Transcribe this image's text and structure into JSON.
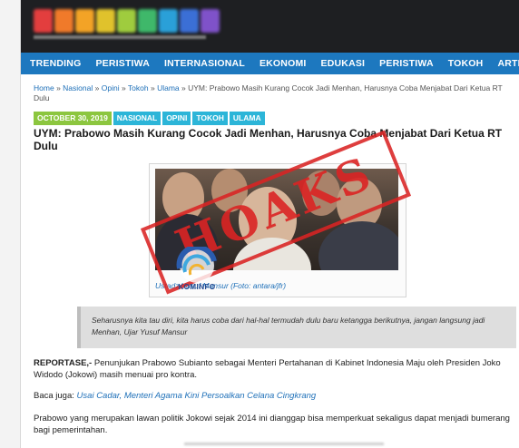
{
  "nav": {
    "items": [
      "TRENDING",
      "PERISTIWA",
      "INTERNASIONAL",
      "EKONOMI",
      "EDUKASI",
      "PERISTIWA",
      "TOKOH",
      "ARTIS"
    ]
  },
  "breadcrumb": {
    "home": "Home",
    "sep": "»",
    "nasional": "Nasional",
    "opini": "Opini",
    "tokoh": "Tokoh",
    "ulama": "Ulama",
    "current": "UYM: Prabowo Masih Kurang Cocok Jadi Menhan, Harusnya Coba Menjabat Dari Ketua RT Dulu"
  },
  "tags": {
    "date": "OCTOBER 30, 2019",
    "categories": [
      "NASIONAL",
      "OPINI",
      "TOKOH",
      "ULAMA"
    ]
  },
  "article": {
    "title": "UYM: Prabowo Masih Kurang Cocok Jadi Menhan, Harusnya Coba Menjabat Dari Ketua RT Dulu",
    "photo_caption": "Ustadz Yusuf Mansur (Foto: antara/jfr)",
    "quote": "Seharusnya kita tau diri, kita harus coba dari hal-hal termudah dulu baru ketangga berikutnya, jangan langsung jadi Menhan, Ujar Yusuf Mansur",
    "lead_label": "REPORTASE,-",
    "lead_text": " Penunjukan Prabowo Subianto sebagai Menteri Pertahanan di Kabinet Indonesia Maju oleh Presiden Joko Widodo (Jokowi) masih menuai pro kontra.",
    "related_label": "Baca juga:",
    "related_link": "Usai Cadar, Menteri Agama Kini Persoalkan Celana Cingkrang",
    "body_text": "Prabowo yang merupakan lawan politik Jokowi sejak 2014 ini dianggap bisa memperkuat sekaligus dapat menjadi bumerang bagi pemerintahan."
  },
  "overlay": {
    "stamp_text": "HOAKS",
    "kominfo_text": "KOMINFO"
  },
  "colors": {
    "header_bg": "#1e1f22",
    "nav_bg": "#1d78bf",
    "link": "#1d6fb8",
    "date_tag": "#8cc63f",
    "category_tag": "#2cb5d8",
    "stamp": "#da2323",
    "logo_letters": [
      "#e33e3e",
      "#f07a2a",
      "#f3a326",
      "#e0c22c",
      "#9fcc3e",
      "#3fb86a",
      "#2aa0d8",
      "#3b6fd6",
      "#7f52c9"
    ]
  },
  "icons": {
    "logo": "site-logo-blurred",
    "kominfo": "kominfo-logo"
  }
}
